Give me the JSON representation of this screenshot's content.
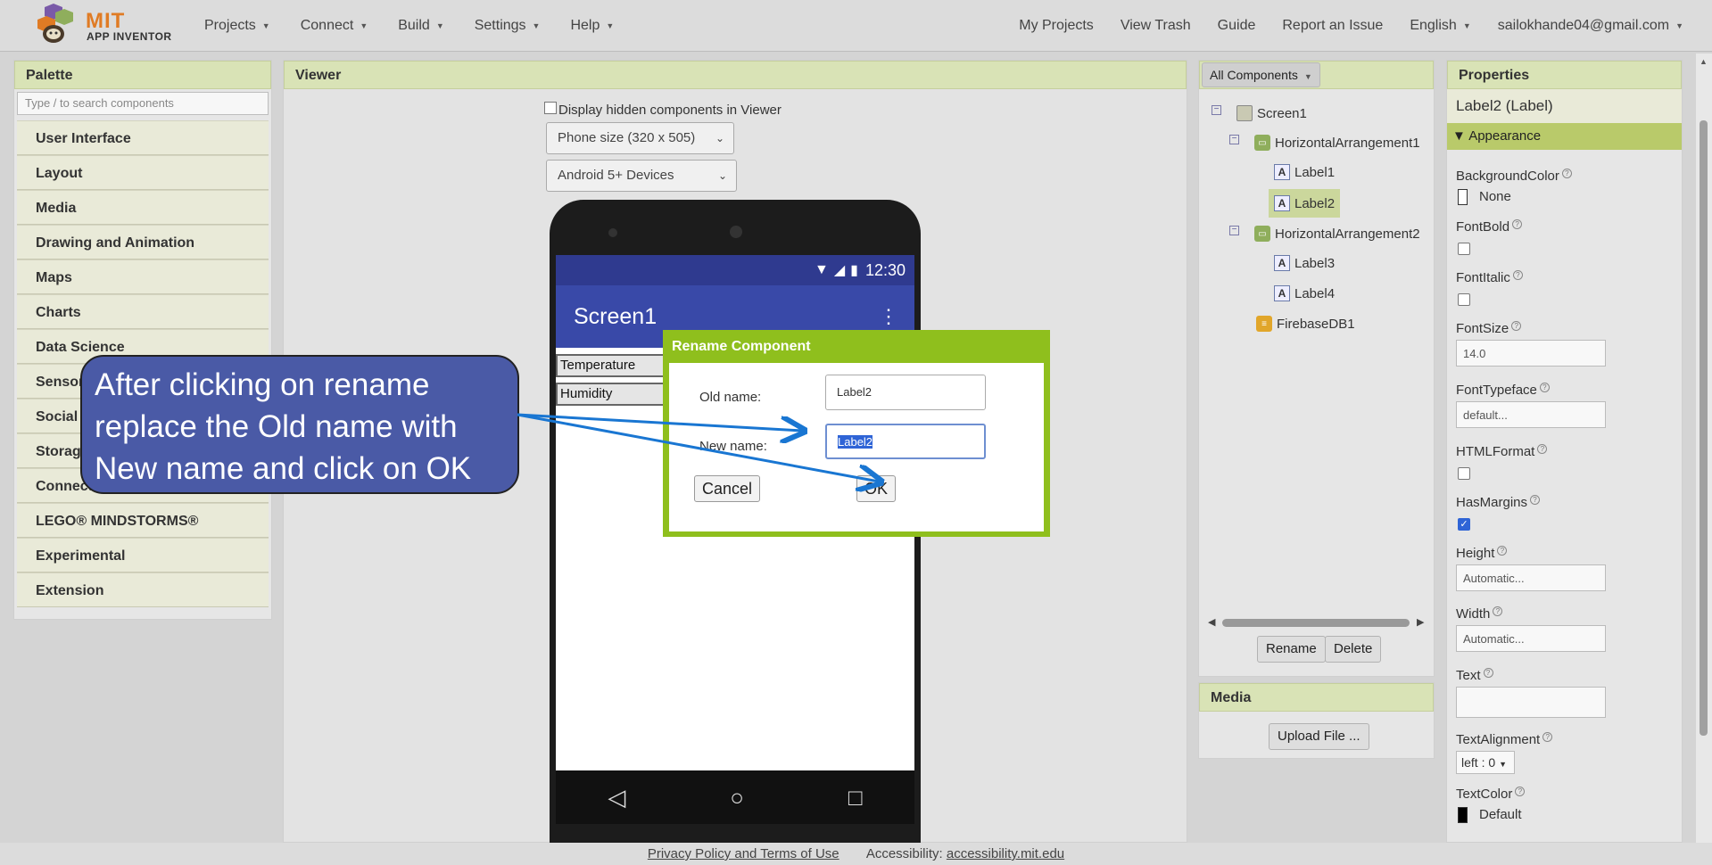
{
  "topbar": {
    "logo_mit": "MIT",
    "logo_sub": "APP INVENTOR",
    "nav_left": [
      "Projects",
      "Connect",
      "Build",
      "Settings",
      "Help"
    ],
    "nav_right": [
      "My Projects",
      "View Trash",
      "Guide",
      "Report an Issue"
    ],
    "language": "English",
    "account": "sailokhande04@gmail.com"
  },
  "palette": {
    "title": "Palette",
    "search_placeholder": "Type / to search components",
    "categories": [
      "User Interface",
      "Layout",
      "Media",
      "Drawing and Animation",
      "Maps",
      "Charts",
      "Data Science",
      "Sensors",
      "Social",
      "Storage",
      "Connectivity",
      "LEGO® MINDSTORMS®",
      "Experimental",
      "Extension"
    ]
  },
  "viewer": {
    "title": "Viewer",
    "hidden_label": "Display hidden components in Viewer",
    "phone_size": "Phone size (320 x 505)",
    "device": "Android 5+ Devices",
    "status_time": "12:30",
    "screen_title": "Screen1",
    "labels": [
      "Temperature",
      "Humidity"
    ]
  },
  "components": {
    "filter": "All Components",
    "tree": [
      "Screen1",
      "HorizontalArrangement1",
      "Label1",
      "Label2",
      "HorizontalArrangement2",
      "Label3",
      "Label4",
      "FirebaseDB1"
    ],
    "rename": "Rename",
    "delete": "Delete"
  },
  "media": {
    "title": "Media",
    "upload": "Upload File ..."
  },
  "properties": {
    "title": "Properties",
    "component": "Label2 (Label)",
    "section": "Appearance",
    "background_color_label": "BackgroundColor",
    "background_color_value": "None",
    "font_bold_label": "FontBold",
    "font_italic_label": "FontItalic",
    "font_size_label": "FontSize",
    "font_size_value": "14.0",
    "font_typeface_label": "FontTypeface",
    "font_typeface_value": "default...",
    "html_format_label": "HTMLFormat",
    "has_margins_label": "HasMargins",
    "height_label": "Height",
    "height_value": "Automatic...",
    "width_label": "Width",
    "width_value": "Automatic...",
    "text_label": "Text",
    "text_alignment_label": "TextAlignment",
    "text_alignment_value": "left : 0",
    "text_color_label": "TextColor",
    "text_color_value": "Default",
    "has_margins_checked": true
  },
  "dialog": {
    "title": "Rename Component",
    "old_label": "Old name:",
    "old_value": "Label2",
    "new_label": "New name:",
    "new_value": "Label2",
    "cancel": "Cancel",
    "ok": "OK"
  },
  "callout": {
    "text": "After clicking on rename replace the Old name with New name and click on OK"
  },
  "footer": {
    "privacy": "Privacy Policy and Terms of Use",
    "accessibility_label": "Accessibility:",
    "accessibility_link": "accessibility.mit.edu"
  },
  "colors": {
    "dialog_border": "#8fbf1d",
    "callout_fill": "#4a5aa6",
    "arrow": "#1976d2",
    "app_bar": "#3949a8"
  }
}
